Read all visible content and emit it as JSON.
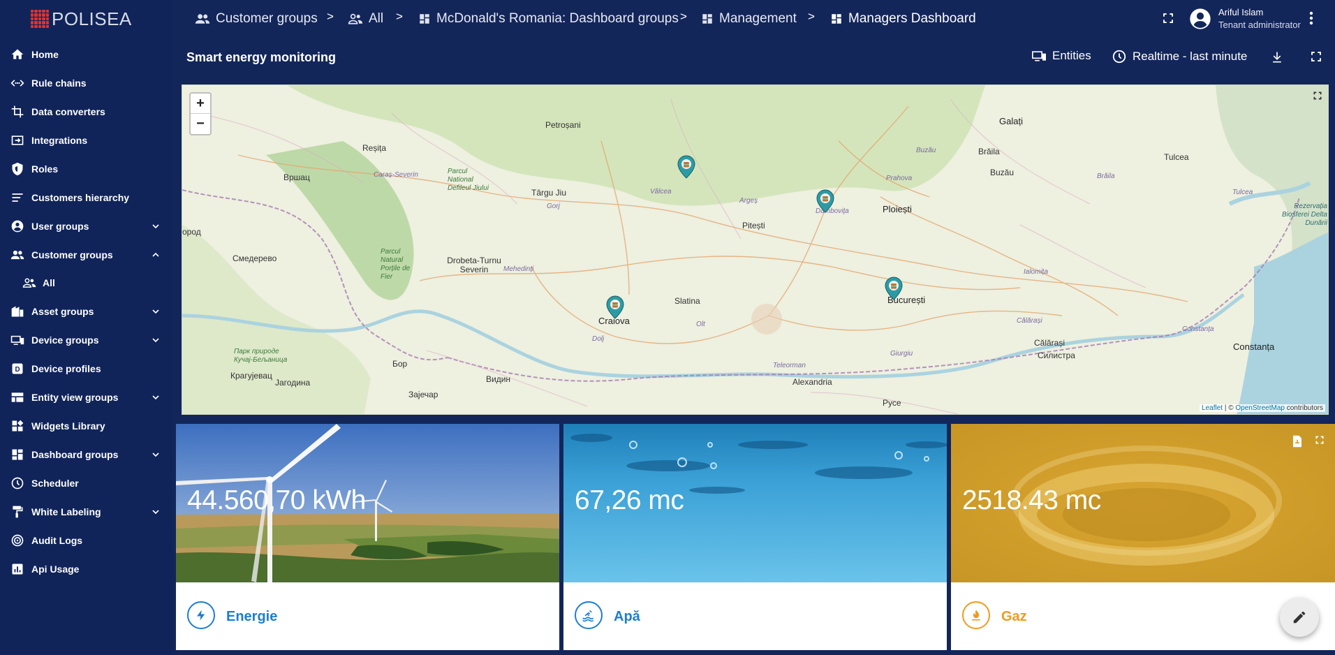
{
  "brand": {
    "name": "POLISEA"
  },
  "sidebar": {
    "items": [
      {
        "label": "Home",
        "icon": "home-icon"
      },
      {
        "label": "Rule chains",
        "icon": "rule-chains-icon"
      },
      {
        "label": "Data converters",
        "icon": "data-converters-icon"
      },
      {
        "label": "Integrations",
        "icon": "integrations-icon"
      },
      {
        "label": "Roles",
        "icon": "roles-shield-icon"
      },
      {
        "label": "Customers hierarchy",
        "icon": "hierarchy-icon"
      },
      {
        "label": "User groups",
        "icon": "user-groups-icon"
      },
      {
        "label": "Customer groups",
        "icon": "customer-groups-icon"
      },
      {
        "label": "All",
        "icon": "group-icon"
      },
      {
        "label": "Asset groups",
        "icon": "asset-groups-icon"
      },
      {
        "label": "Device groups",
        "icon": "device-groups-icon"
      },
      {
        "label": "Device profiles",
        "icon": "device-profiles-icon"
      },
      {
        "label": "Entity view groups",
        "icon": "entity-view-icon"
      },
      {
        "label": "Widgets Library",
        "icon": "widgets-icon"
      },
      {
        "label": "Dashboard groups",
        "icon": "dashboard-groups-icon"
      },
      {
        "label": "Scheduler",
        "icon": "clock-icon"
      },
      {
        "label": "White Labeling",
        "icon": "paint-roller-icon"
      },
      {
        "label": "Audit Logs",
        "icon": "audit-logs-icon"
      },
      {
        "label": "Api Usage",
        "icon": "chart-icon"
      }
    ]
  },
  "breadcrumb": [
    {
      "label": "Customer groups",
      "icon": "customer-groups-icon"
    },
    {
      "label": "All",
      "icon": "group-icon"
    },
    {
      "label": "McDonald's Romania: Dashboard groups",
      "icon": "dashboard-icon"
    },
    {
      "label": "Management",
      "icon": "dashboard-icon"
    },
    {
      "label": "Managers Dashboard",
      "icon": "dashboard-icon"
    }
  ],
  "breadcrumb_separator": ">",
  "user": {
    "name": "Ariful Islam",
    "role": "Tenant administrator"
  },
  "dashboard": {
    "title": "Smart energy monitoring",
    "entities_label": "Entities",
    "timewindow_label": "Realtime - last minute"
  },
  "map": {
    "zoom_in": "+",
    "zoom_out": "−",
    "cities": [
      "Galați",
      "Petroșani",
      "Reșița",
      "Brăila",
      "Tulcea",
      "Вршац",
      "Buzău",
      "Buzău",
      "Caraș-Severin",
      "Parcul National Defileul Jiului",
      "Târgu Jiu",
      "Vâlcea",
      "Prahova",
      "Brăila",
      "Tulcea",
      "Rezervația Biosferei Delta Dunării",
      "Gorj",
      "Argeș",
      "Dâmbovița",
      "Ploiești",
      "ород",
      "Смедерево",
      "Parcul Natural Porțile de Fier",
      "Drobeta-Turnu Severin",
      "Mehedinți",
      "Pitești",
      "Ialomița",
      "Slatina",
      "Craiova",
      "București",
      "Olt",
      "Călărași",
      "Constanța",
      "Constanța",
      "Dolj",
      "Călărași",
      "Силистра",
      "Парк природе Кучај-Бељаница",
      "Бор",
      "Giurgiu",
      "Крагујевац",
      "Јагодина",
      "Видин",
      "Teleorman",
      "Alexandria",
      "Зајечар",
      "Русе"
    ],
    "attribution_leaflet": "Leaflet",
    "attribution_rest": " | © ",
    "attribution_osm": "OpenStreetMap",
    "attribution_tail": " contributors"
  },
  "cards": [
    {
      "value": "44.560,70 kWh",
      "label": "Energie",
      "color": "#1c7ed0",
      "icon": "lightning-icon"
    },
    {
      "value": "67,26 mc",
      "label": "Apă",
      "color": "#1c7ed0",
      "icon": "water-icon"
    },
    {
      "value": "2518.43 mc",
      "label": "Gaz",
      "color": "#f29a1f",
      "icon": "flame-icon"
    }
  ],
  "colors": {
    "sidebar": "#10245a",
    "topbar": "#13265a",
    "accent": "#1c7ed0",
    "gas": "#f29a1f"
  }
}
